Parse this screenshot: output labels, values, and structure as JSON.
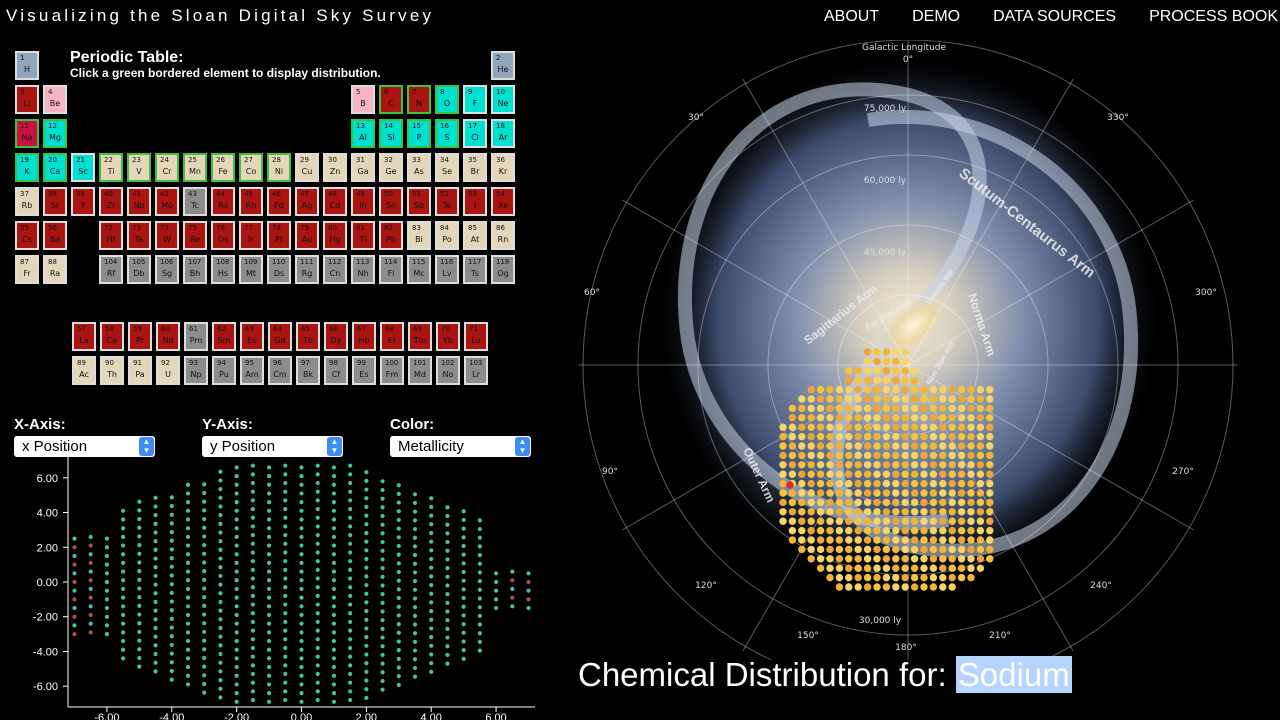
{
  "header": {
    "title": "Visualizing the Sloan Digital Sky Survey",
    "nav": [
      "ABOUT",
      "DEMO",
      "DATA SOURCES",
      "PROCESS BOOK"
    ]
  },
  "periodic_table": {
    "title": "Periodic Table:",
    "subtitle": "Click a green bordered element to display distribution.",
    "colors": {
      "teal": "#00e0d0",
      "red": "#aa1511",
      "pink": "#f7b3c3",
      "tan": "#e4d6b8",
      "gray": "#8c8c8c",
      "slate": "#8fa6bd",
      "crimson": "#c8143c"
    }
  },
  "controls": {
    "x_label": "X-Axis:",
    "x_value": "x Position",
    "y_label": "Y-Axis:",
    "y_value": "y Position",
    "color_label": "Color:",
    "color_value": "Metallicity"
  },
  "scatter_chart": {
    "type": "scatter",
    "x_ticks": [
      "-6.00",
      "-4.00",
      "-2.00",
      "0.00",
      "2.00",
      "4.00",
      "6.00"
    ],
    "y_ticks": [
      "6.00",
      "4.00",
      "2.00",
      "0.00",
      "-2.00",
      "-4.00",
      "-6.00"
    ],
    "xlim": [
      -7.2,
      7.2
    ],
    "ylim": [
      -7.2,
      7.2
    ],
    "point_color": "#3fc2a6",
    "outlier_color": "#a5533e"
  },
  "galaxy_map": {
    "top_label": "Galactic Longitude",
    "angle_labels": [
      "0°",
      "30°",
      "330°",
      "60°",
      "300°",
      "90°",
      "270°",
      "120°",
      "240°",
      "150°",
      "210°",
      "180°"
    ],
    "ring_labels": [
      "75,000 ly",
      "60,000 ly",
      "45,000 ly",
      "30,000 ly"
    ],
    "arm_labels": [
      "Scutum-Centaurus Arm",
      "Sagittarius Arm",
      "Norma Arm",
      "Outer Arm",
      "Far 3kpc Arm",
      "Galactic Bar",
      "Near 3kpc Arm"
    ]
  },
  "chemical": {
    "prefix": "Chemical Distribution for:",
    "element": "Sodium"
  }
}
